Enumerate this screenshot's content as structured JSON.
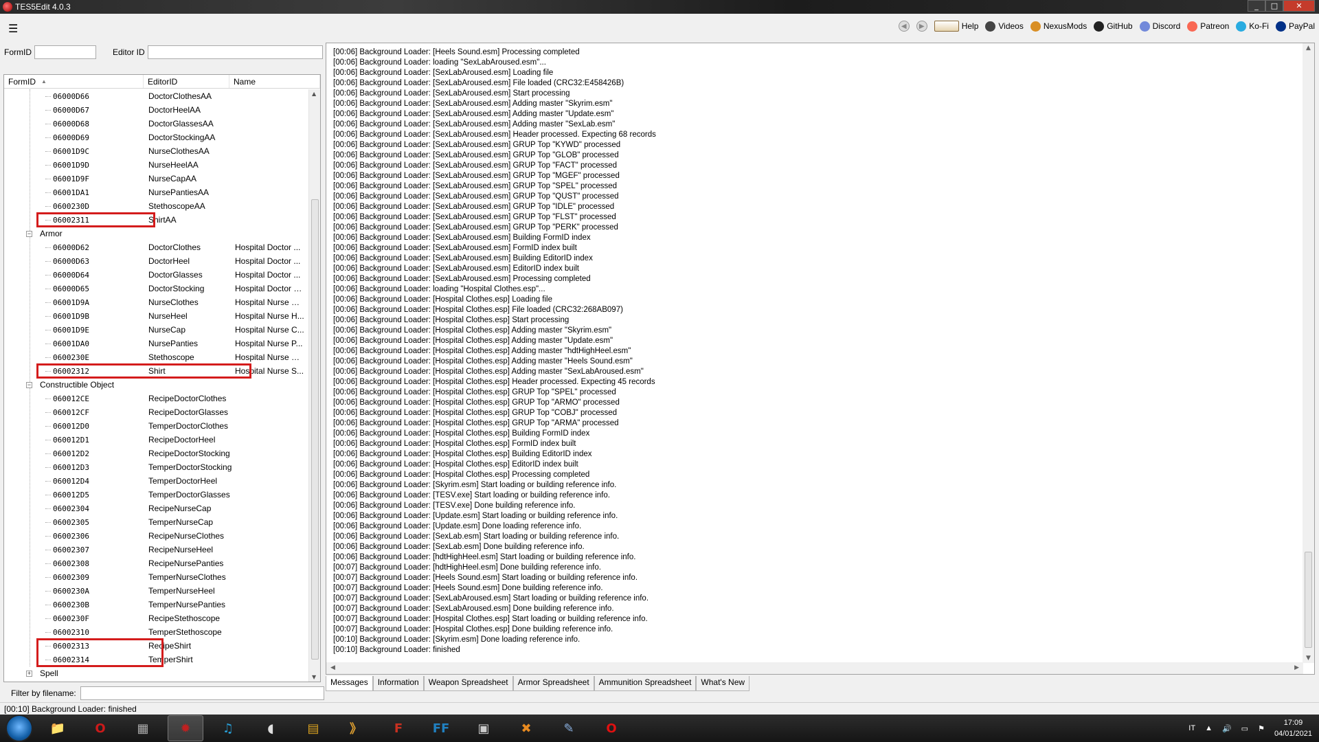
{
  "window": {
    "title": "TES5Edit 4.0.3",
    "controls": [
      "_",
      "□",
      "✕"
    ]
  },
  "toolbar": {
    "menu_icon": "☰",
    "buttons": [
      {
        "label": "Help",
        "icon": "book-icon",
        "color": "#8a6a3a"
      },
      {
        "label": "Videos",
        "icon": "video-icon",
        "color": "#444444"
      },
      {
        "label": "NexusMods",
        "icon": "nexusmods-icon",
        "color": "#d98f25"
      },
      {
        "label": "GitHub",
        "icon": "github-icon",
        "color": "#222222"
      },
      {
        "label": "Discord",
        "icon": "discord-icon",
        "color": "#7289da"
      },
      {
        "label": "Patreon",
        "icon": "patreon-icon",
        "color": "#f96854"
      },
      {
        "label": "Ko-Fi",
        "icon": "kofi-icon",
        "color": "#29abe0"
      },
      {
        "label": "PayPal",
        "icon": "paypal-icon",
        "color": "#003087"
      }
    ]
  },
  "filters": {
    "formid_label": "FormID",
    "editorid_label": "Editor ID",
    "filename_label": "Filter by filename:"
  },
  "tree": {
    "columns": [
      "FormID",
      "EditorID",
      "Name"
    ],
    "sort_indicator": "▲",
    "rows": [
      {
        "type": "item",
        "fid": "06000D66",
        "eid": "DoctorClothesAA",
        "name": ""
      },
      {
        "type": "item",
        "fid": "06000D67",
        "eid": "DoctorHeelAA",
        "name": ""
      },
      {
        "type": "item",
        "fid": "06000D68",
        "eid": "DoctorGlassesAA",
        "name": ""
      },
      {
        "type": "item",
        "fid": "06000D69",
        "eid": "DoctorStockingAA",
        "name": ""
      },
      {
        "type": "item",
        "fid": "06001D9C",
        "eid": "NurseClothesAA",
        "name": ""
      },
      {
        "type": "item",
        "fid": "06001D9D",
        "eid": "NurseHeelAA",
        "name": ""
      },
      {
        "type": "item",
        "fid": "06001D9F",
        "eid": "NurseCapAA",
        "name": ""
      },
      {
        "type": "item",
        "fid": "06001DA1",
        "eid": "NursePantiesAA",
        "name": ""
      },
      {
        "type": "item",
        "fid": "0600230D",
        "eid": "StethoscopeAA",
        "name": ""
      },
      {
        "type": "item",
        "fid": "06002311",
        "eid": "ShirtAA",
        "name": ""
      },
      {
        "type": "group",
        "label": "Armor",
        "expander": "−"
      },
      {
        "type": "item",
        "fid": "06000D62",
        "eid": "DoctorClothes",
        "name": "Hospital Doctor ..."
      },
      {
        "type": "item",
        "fid": "06000D63",
        "eid": "DoctorHeel",
        "name": "Hospital Doctor ..."
      },
      {
        "type": "item",
        "fid": "06000D64",
        "eid": "DoctorGlasses",
        "name": "Hospital Doctor ..."
      },
      {
        "type": "item",
        "fid": "06000D65",
        "eid": "DoctorStocking",
        "name": "Hospital Doctor S..."
      },
      {
        "type": "item",
        "fid": "06001D9A",
        "eid": "NurseClothes",
        "name": "Hospital Nurse Cl..."
      },
      {
        "type": "item",
        "fid": "06001D9B",
        "eid": "NurseHeel",
        "name": "Hospital Nurse H..."
      },
      {
        "type": "item",
        "fid": "06001D9E",
        "eid": "NurseCap",
        "name": "Hospital Nurse C..."
      },
      {
        "type": "item",
        "fid": "06001DA0",
        "eid": "NursePanties",
        "name": "Hospital Nurse P..."
      },
      {
        "type": "item",
        "fid": "0600230E",
        "eid": "Stethoscope",
        "name": "Hospital Nurse St..."
      },
      {
        "type": "item",
        "fid": "06002312",
        "eid": "Shirt",
        "name": "Hospital Nurse S..."
      },
      {
        "type": "group",
        "label": "Constructible Object",
        "expander": "−"
      },
      {
        "type": "item",
        "fid": "060012CE",
        "eid": "RecipeDoctorClothes",
        "name": ""
      },
      {
        "type": "item",
        "fid": "060012CF",
        "eid": "RecipeDoctorGlasses",
        "name": ""
      },
      {
        "type": "item",
        "fid": "060012D0",
        "eid": "TemperDoctorClothes",
        "name": ""
      },
      {
        "type": "item",
        "fid": "060012D1",
        "eid": "RecipeDoctorHeel",
        "name": ""
      },
      {
        "type": "item",
        "fid": "060012D2",
        "eid": "RecipeDoctorStocking",
        "name": ""
      },
      {
        "type": "item",
        "fid": "060012D3",
        "eid": "TemperDoctorStocking",
        "name": ""
      },
      {
        "type": "item",
        "fid": "060012D4",
        "eid": "TemperDoctorHeel",
        "name": ""
      },
      {
        "type": "item",
        "fid": "060012D5",
        "eid": "TemperDoctorGlasses",
        "name": ""
      },
      {
        "type": "item",
        "fid": "06002304",
        "eid": "RecipeNurseCap",
        "name": ""
      },
      {
        "type": "item",
        "fid": "06002305",
        "eid": "TemperNurseCap",
        "name": ""
      },
      {
        "type": "item",
        "fid": "06002306",
        "eid": "RecipeNurseClothes",
        "name": ""
      },
      {
        "type": "item",
        "fid": "06002307",
        "eid": "RecipeNurseHeel",
        "name": ""
      },
      {
        "type": "item",
        "fid": "06002308",
        "eid": "RecipeNursePanties",
        "name": ""
      },
      {
        "type": "item",
        "fid": "06002309",
        "eid": "TemperNurseClothes",
        "name": ""
      },
      {
        "type": "item",
        "fid": "0600230A",
        "eid": "TemperNurseHeel",
        "name": ""
      },
      {
        "type": "item",
        "fid": "0600230B",
        "eid": "TemperNursePanties",
        "name": ""
      },
      {
        "type": "item",
        "fid": "0600230F",
        "eid": "RecipeStethoscope",
        "name": ""
      },
      {
        "type": "item",
        "fid": "06002310",
        "eid": "TemperStethoscope",
        "name": ""
      },
      {
        "type": "item",
        "fid": "06002313",
        "eid": "RecipeShirt",
        "name": ""
      },
      {
        "type": "item",
        "fid": "06002314",
        "eid": "TemperShirt",
        "name": ""
      },
      {
        "type": "group",
        "label": "Spell",
        "expander": "+"
      }
    ]
  },
  "messages": {
    "lines": [
      "[00:06] Background Loader: [Heels Sound.esm] Processing completed",
      "[00:06] Background Loader: loading \"SexLabAroused.esm\"...",
      "[00:06] Background Loader: [SexLabAroused.esm] Loading file",
      "[00:06] Background Loader: [SexLabAroused.esm] File loaded (CRC32:E458426B)",
      "[00:06] Background Loader: [SexLabAroused.esm] Start processing",
      "[00:06] Background Loader: [SexLabAroused.esm] Adding master \"Skyrim.esm\"",
      "[00:06] Background Loader: [SexLabAroused.esm] Adding master \"Update.esm\"",
      "[00:06] Background Loader: [SexLabAroused.esm] Adding master \"SexLab.esm\"",
      "[00:06] Background Loader: [SexLabAroused.esm] Header processed. Expecting 68 records",
      "[00:06] Background Loader: [SexLabAroused.esm] GRUP Top \"KYWD\" processed",
      "[00:06] Background Loader: [SexLabAroused.esm] GRUP Top \"GLOB\" processed",
      "[00:06] Background Loader: [SexLabAroused.esm] GRUP Top \"FACT\" processed",
      "[00:06] Background Loader: [SexLabAroused.esm] GRUP Top \"MGEF\" processed",
      "[00:06] Background Loader: [SexLabAroused.esm] GRUP Top \"SPEL\" processed",
      "[00:06] Background Loader: [SexLabAroused.esm] GRUP Top \"QUST\" processed",
      "[00:06] Background Loader: [SexLabAroused.esm] GRUP Top \"IDLE\" processed",
      "[00:06] Background Loader: [SexLabAroused.esm] GRUP Top \"FLST\" processed",
      "[00:06] Background Loader: [SexLabAroused.esm] GRUP Top \"PERK\" processed",
      "[00:06] Background Loader: [SexLabAroused.esm] Building FormID index",
      "[00:06] Background Loader: [SexLabAroused.esm] FormID index built",
      "[00:06] Background Loader: [SexLabAroused.esm] Building EditorID index",
      "[00:06] Background Loader: [SexLabAroused.esm] EditorID index built",
      "[00:06] Background Loader: [SexLabAroused.esm] Processing completed",
      "[00:06] Background Loader: loading \"Hospital Clothes.esp\"...",
      "[00:06] Background Loader: [Hospital Clothes.esp] Loading file",
      "[00:06] Background Loader: [Hospital Clothes.esp] File loaded (CRC32:268AB097)",
      "[00:06] Background Loader: [Hospital Clothes.esp] Start processing",
      "[00:06] Background Loader: [Hospital Clothes.esp] Adding master \"Skyrim.esm\"",
      "[00:06] Background Loader: [Hospital Clothes.esp] Adding master \"Update.esm\"",
      "[00:06] Background Loader: [Hospital Clothes.esp] Adding master \"hdtHighHeel.esm\"",
      "[00:06] Background Loader: [Hospital Clothes.esp] Adding master \"Heels Sound.esm\"",
      "[00:06] Background Loader: [Hospital Clothes.esp] Adding master \"SexLabAroused.esm\"",
      "[00:06] Background Loader: [Hospital Clothes.esp] Header processed. Expecting 45 records",
      "[00:06] Background Loader: [Hospital Clothes.esp] GRUP Top \"SPEL\" processed",
      "[00:06] Background Loader: [Hospital Clothes.esp] GRUP Top \"ARMO\" processed",
      "[00:06] Background Loader: [Hospital Clothes.esp] GRUP Top \"COBJ\" processed",
      "[00:06] Background Loader: [Hospital Clothes.esp] GRUP Top \"ARMA\" processed",
      "[00:06] Background Loader: [Hospital Clothes.esp] Building FormID index",
      "[00:06] Background Loader: [Hospital Clothes.esp] FormID index built",
      "[00:06] Background Loader: [Hospital Clothes.esp] Building EditorID index",
      "[00:06] Background Loader: [Hospital Clothes.esp] EditorID index built",
      "[00:06] Background Loader: [Hospital Clothes.esp] Processing completed",
      "[00:06] Background Loader: [Skyrim.esm] Start loading or building reference info.",
      "[00:06] Background Loader: [TESV.exe] Start loading or building reference info.",
      "[00:06] Background Loader: [TESV.exe] Done building reference info.",
      "[00:06] Background Loader: [Update.esm] Start loading or building reference info.",
      "[00:06] Background Loader: [Update.esm] Done loading reference info.",
      "[00:06] Background Loader: [SexLab.esm] Start loading or building reference info.",
      "[00:06] Background Loader: [SexLab.esm] Done building reference info.",
      "[00:06] Background Loader: [hdtHighHeel.esm] Start loading or building reference info.",
      "[00:07] Background Loader: [hdtHighHeel.esm] Done building reference info.",
      "[00:07] Background Loader: [Heels Sound.esm] Start loading or building reference info.",
      "[00:07] Background Loader: [Heels Sound.esm] Done building reference info.",
      "[00:07] Background Loader: [SexLabAroused.esm] Start loading or building reference info.",
      "[00:07] Background Loader: [SexLabAroused.esm] Done building reference info.",
      "[00:07] Background Loader: [Hospital Clothes.esp] Start loading or building reference info.",
      "[00:07] Background Loader: [Hospital Clothes.esp] Done building reference info.",
      "[00:10] Background Loader: [Skyrim.esm] Done loading reference info.",
      "[00:10] Background Loader: finished"
    ]
  },
  "tabs": [
    "Messages",
    "Information",
    "Weapon Spreadsheet",
    "Armor Spreadsheet",
    "Ammunition Spreadsheet",
    "What's New"
  ],
  "status": "[00:10] Background Loader: finished",
  "taskbar": {
    "icons": [
      {
        "name": "explorer-icon",
        "glyph": "📁",
        "color": "#e8b84a"
      },
      {
        "name": "opera-icon",
        "glyph": "O",
        "color": "#cc1a1a"
      },
      {
        "name": "media-icon",
        "glyph": "▦",
        "color": "#aaaaaa"
      },
      {
        "name": "tes5edit-icon",
        "glyph": "✹",
        "color": "#c02020"
      },
      {
        "name": "music-icon",
        "glyph": "♫",
        "color": "#28a0d8"
      },
      {
        "name": "audio-icon",
        "glyph": "◖",
        "color": "#dddddd"
      },
      {
        "name": "notes-icon",
        "glyph": "▤",
        "color": "#d8a020"
      },
      {
        "name": "script-icon",
        "glyph": "》",
        "color": "#e0a030"
      },
      {
        "name": "filezilla-icon",
        "glyph": "F",
        "color": "#c83020"
      },
      {
        "name": "ffdec-icon",
        "glyph": "FF",
        "color": "#2080c0"
      },
      {
        "name": "window-icon",
        "glyph": "▣",
        "color": "#cccccc"
      },
      {
        "name": "xnview-icon",
        "glyph": "✖",
        "color": "#e88a20"
      },
      {
        "name": "pen-icon",
        "glyph": "✎",
        "color": "#8ab0e0"
      },
      {
        "name": "opera-gx-icon",
        "glyph": "O",
        "color": "#e01010"
      }
    ],
    "lang": "IT",
    "time": "17:09",
    "date": "04/01/2021"
  }
}
